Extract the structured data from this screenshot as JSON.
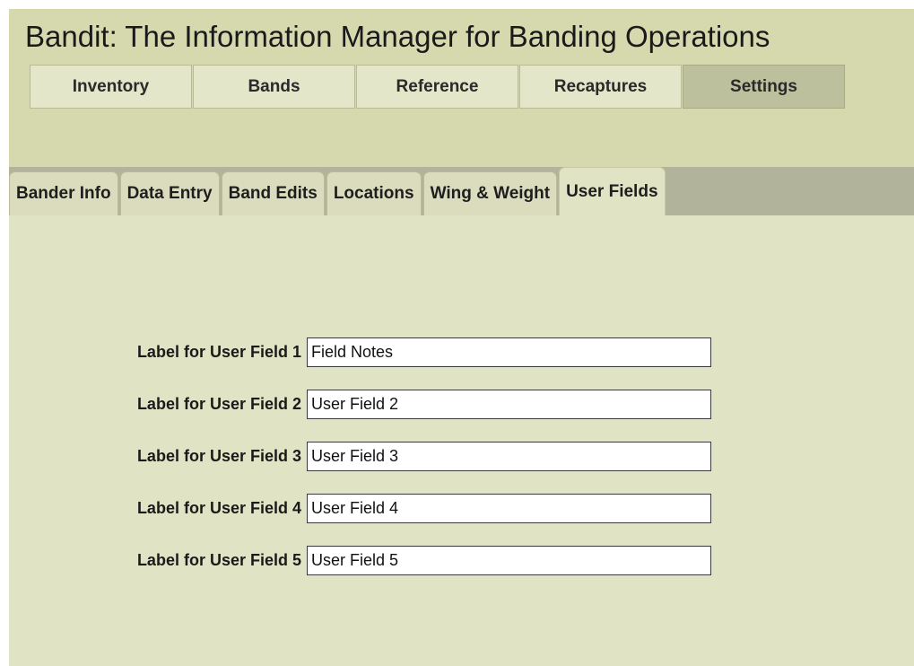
{
  "app": {
    "title": "Bandit: The Information Manager for Banding Operations"
  },
  "main_tabs": [
    {
      "label": "Inventory"
    },
    {
      "label": "Bands"
    },
    {
      "label": "Reference"
    },
    {
      "label": "Recaptures"
    },
    {
      "label": "Settings",
      "active": true
    }
  ],
  "settings_tabs": [
    {
      "label": "Bander Info"
    },
    {
      "label": "Data Entry"
    },
    {
      "label": "Band Edits"
    },
    {
      "label": "Locations"
    },
    {
      "label": "Wing & Weight"
    },
    {
      "label": "User Fields",
      "active": true
    }
  ],
  "user_fields": [
    {
      "label": "Label for User Field 1",
      "value": "Field Notes"
    },
    {
      "label": "Label for User Field 2",
      "value": "User Field 2"
    },
    {
      "label": "Label for User Field 3",
      "value": "User Field 3"
    },
    {
      "label": "Label for User Field 4",
      "value": "User Field 4"
    },
    {
      "label": "Label for User Field 5",
      "value": "User Field 5"
    }
  ],
  "colors": {
    "panel_background": "#e1e4c4",
    "header_background": "#d6d9ae",
    "tab_strip_background": "#b1b49a",
    "active_main_tab": "#bdc09c"
  }
}
